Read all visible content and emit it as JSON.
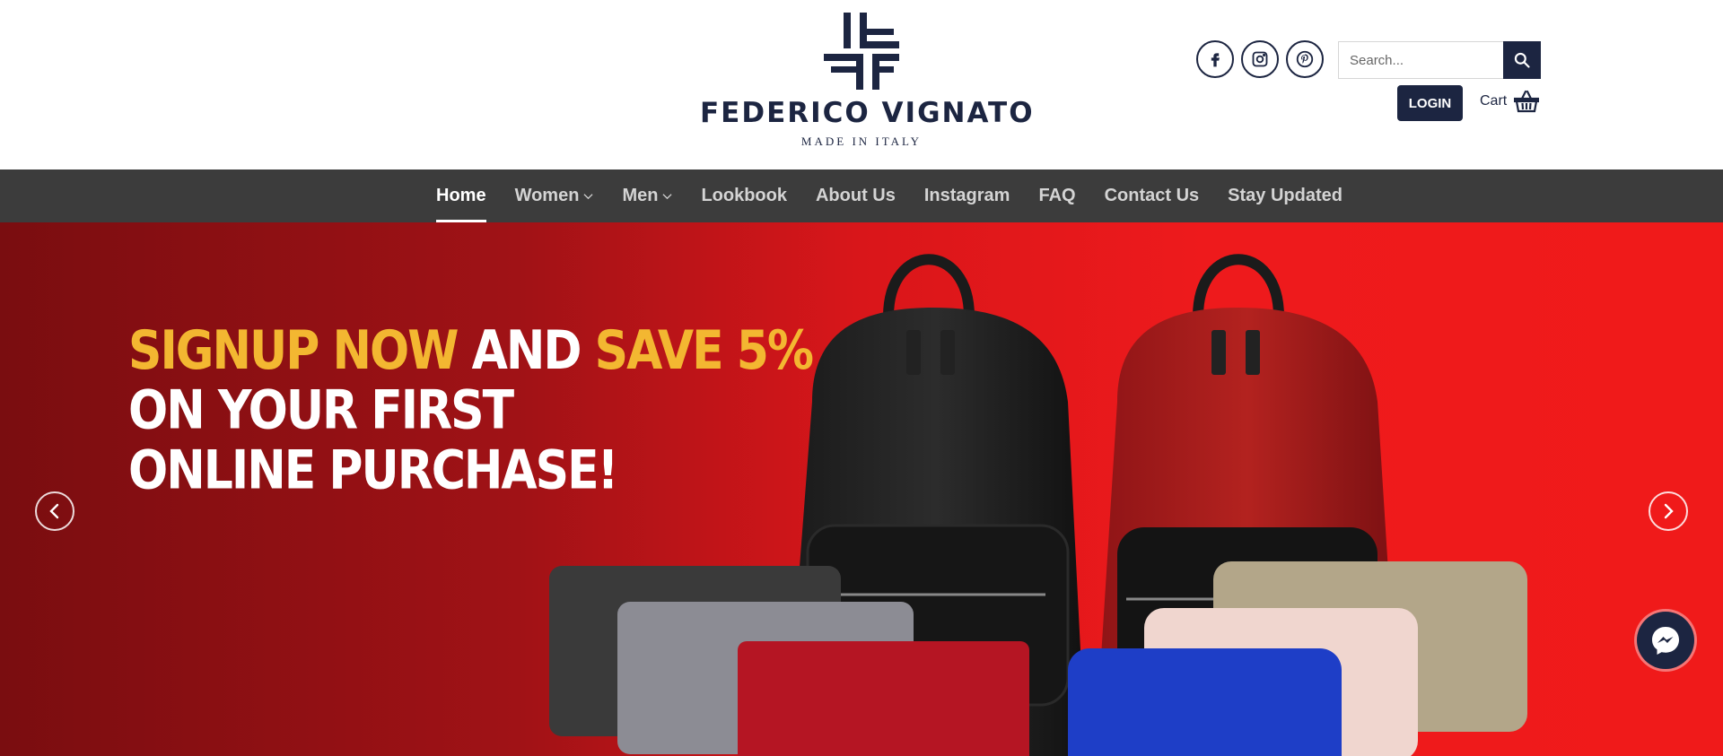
{
  "brand": {
    "name": "FEDERICO VIGNATO",
    "tagline": "MADE IN ITALY",
    "color": "#1c2541"
  },
  "header": {
    "social": [
      {
        "name": "facebook-icon",
        "glyph": "f"
      },
      {
        "name": "instagram-icon",
        "glyph": "ig"
      },
      {
        "name": "pinterest-icon",
        "glyph": "p"
      }
    ],
    "search": {
      "placeholder": "Search..."
    },
    "login_label": "LOGIN",
    "cart_label": "Cart"
  },
  "nav": {
    "items": [
      {
        "label": "Home",
        "active": true
      },
      {
        "label": "Women",
        "dropdown": true
      },
      {
        "label": "Men",
        "dropdown": true
      },
      {
        "label": "Lookbook"
      },
      {
        "label": "About Us"
      },
      {
        "label": "Instagram"
      },
      {
        "label": "FAQ"
      },
      {
        "label": "Contact Us"
      },
      {
        "label": "Stay Updated"
      }
    ]
  },
  "hero": {
    "line1_a": "SIGNUP NOW",
    "line1_b": " AND ",
    "line1_c": "SAVE 5%",
    "line2": "ON YOUR FIRST",
    "line3": "ONLINE PURCHASE!",
    "highlight_color": "#f3b731",
    "background_color": "#ee1a1c"
  },
  "widgets": {
    "messenger_icon": "messenger-icon"
  }
}
